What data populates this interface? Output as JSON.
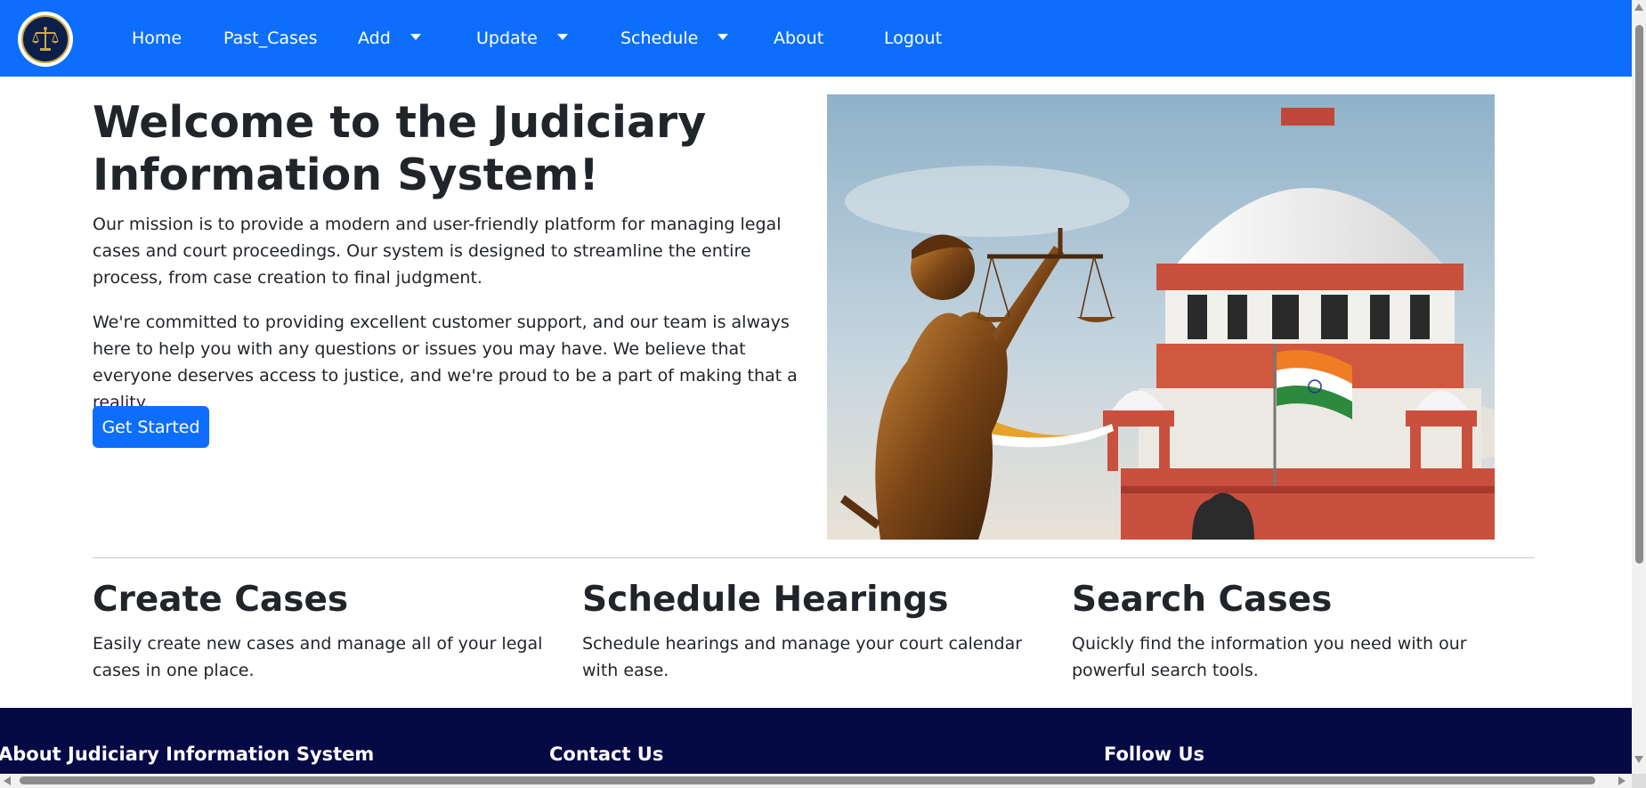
{
  "navbar": {
    "background": "#0d6efd",
    "logo_icon": "scales-of-justice-emblem",
    "items": [
      {
        "label": "Home",
        "dropdown": false
      },
      {
        "label": "Past_Cases",
        "dropdown": false
      },
      {
        "label": "Add",
        "dropdown": true
      },
      {
        "label": "Update",
        "dropdown": true
      },
      {
        "label": "Schedule",
        "dropdown": true
      },
      {
        "label": "About",
        "dropdown": false
      },
      {
        "label": "Logout",
        "dropdown": false
      }
    ]
  },
  "hero": {
    "title": "Welcome to the Judiciary Information System!",
    "paragraph1": "Our mission is to provide a modern and user-friendly platform for managing legal cases and court proceedings. Our system is designed to streamline the entire process, from case creation to final judgment.",
    "paragraph2": "We're committed to providing excellent customer support, and our team is always here to help you with any questions or issues you may have. We believe that everyone deserves access to justice, and we're proud to be a part of making that a reality.",
    "cta_label": "Get Started",
    "image_subject": "lady-justice-statue-and-supreme-court-dome"
  },
  "features": [
    {
      "title": "Create Cases",
      "text": "Easily create new cases and manage all of your legal cases in one place."
    },
    {
      "title": "Schedule Hearings",
      "text": "Schedule hearings and manage your court calendar with ease."
    },
    {
      "title": "Search Cases",
      "text": "Quickly find the information you need with our powerful search tools."
    }
  ],
  "footer": {
    "background": "#050a45",
    "headings": [
      "About Judiciary Information System",
      "Contact Us",
      "Follow Us"
    ]
  },
  "colors": {
    "primary": "#0d6efd",
    "text": "#212529",
    "footer": "#050a45"
  }
}
